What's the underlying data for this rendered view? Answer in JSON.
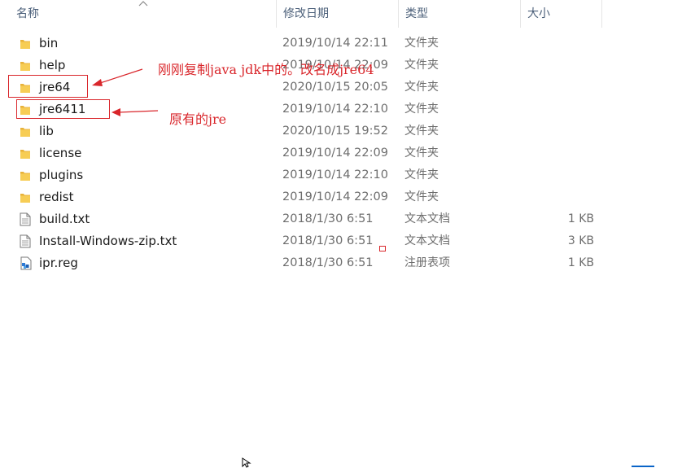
{
  "columns": {
    "name": "名称",
    "date": "修改日期",
    "type": "类型",
    "size": "大小"
  },
  "files": [
    {
      "name": "bin",
      "date": "2019/10/14 22:11",
      "type": "文件夹",
      "size": "",
      "icon": "folder-icon"
    },
    {
      "name": "help",
      "date": "2019/10/14 22:09",
      "type": "文件夹",
      "size": "",
      "icon": "folder-icon"
    },
    {
      "name": "jre64",
      "date": "2020/10/15 20:05",
      "type": "文件夹",
      "size": "",
      "icon": "folder-icon"
    },
    {
      "name": "jre6411",
      "date": "2019/10/14 22:10",
      "type": "文件夹",
      "size": "",
      "icon": "folder-icon"
    },
    {
      "name": "lib",
      "date": "2020/10/15 19:52",
      "type": "文件夹",
      "size": "",
      "icon": "folder-icon"
    },
    {
      "name": "license",
      "date": "2019/10/14 22:09",
      "type": "文件夹",
      "size": "",
      "icon": "folder-icon"
    },
    {
      "name": "plugins",
      "date": "2019/10/14 22:10",
      "type": "文件夹",
      "size": "",
      "icon": "folder-icon"
    },
    {
      "name": "redist",
      "date": "2019/10/14 22:09",
      "type": "文件夹",
      "size": "",
      "icon": "folder-icon"
    },
    {
      "name": "build.txt",
      "date": "2018/1/30 6:51",
      "type": "文本文档",
      "size": "1 KB",
      "icon": "text-file-icon"
    },
    {
      "name": "Install-Windows-zip.txt",
      "date": "2018/1/30 6:51",
      "type": "文本文档",
      "size": "3 KB",
      "icon": "text-file-icon"
    },
    {
      "name": "ipr.reg",
      "date": "2018/1/30 6:51",
      "type": "注册表项",
      "size": "1 KB",
      "icon": "registry-file-icon"
    }
  ],
  "annotations": {
    "jre64_note": "刚刚复制java jdk中的。改名成jre64",
    "jre6411_note": "原有的jre"
  },
  "colors": {
    "annotation": "#d9262b",
    "folder": "#f5c342",
    "header_text": "#4c607a"
  }
}
